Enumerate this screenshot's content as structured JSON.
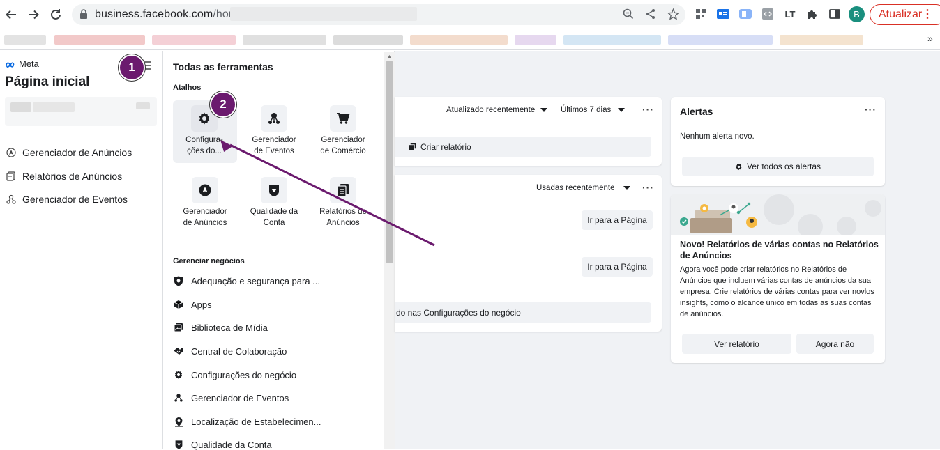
{
  "browser": {
    "url_host": "business.facebook.com",
    "url_path": "/home/a",
    "update_label": "Atualizar",
    "avatar_letter": "B"
  },
  "sidebar": {
    "brand": "Meta",
    "title": "Página inicial",
    "items": [
      {
        "label": "Gerenciador de Anúncios",
        "icon": "navigation-icon"
      },
      {
        "label": "Relatórios de Anúncios",
        "icon": "report-icon"
      },
      {
        "label": "Gerenciador de Eventos",
        "icon": "events-icon"
      }
    ]
  },
  "panel": {
    "title": "Todas as ferramentas",
    "shortcuts_heading": "Atalhos",
    "shortcuts": [
      {
        "line1": "Configura-",
        "line2": "ções do...",
        "icon": "gear-icon"
      },
      {
        "line1": "Gerenciador",
        "line2": "de Eventos",
        "icon": "events-icon"
      },
      {
        "line1": "Gerenciador",
        "line2": "de Comércio",
        "icon": "cart-icon"
      },
      {
        "line1": "Gerenciador",
        "line2": "de Anúncios",
        "icon": "navigation-icon"
      },
      {
        "line1": "Qualidade da",
        "line2": "Conta",
        "icon": "shield-icon"
      },
      {
        "line1": "Relatórios de",
        "line2": "Anúncios",
        "icon": "report-icon"
      }
    ],
    "manage_heading": "Gerenciar negócios",
    "manage_items": [
      {
        "label": "Adequação e segurança para ...",
        "icon": "shield-check-icon"
      },
      {
        "label": "Apps",
        "icon": "cube-icon"
      },
      {
        "label": "Biblioteca de Mídia",
        "icon": "media-icon"
      },
      {
        "label": "Central de Colaboração",
        "icon": "handshake-icon"
      },
      {
        "label": "Configurações do negócio",
        "icon": "gear-icon"
      },
      {
        "label": "Gerenciador de Eventos",
        "icon": "events-icon"
      },
      {
        "label": "Localização de Estabelecimen...",
        "icon": "location-icon"
      },
      {
        "label": "Qualidade da Conta",
        "icon": "shield-icon"
      }
    ]
  },
  "main": {
    "card1": {
      "updated_filter": "Atualizado recentemente",
      "period_filter": "Últimos 7 dias",
      "create_report": "Criar relatório"
    },
    "card2": {
      "used_filter": "Usadas recentemente",
      "go_to_page_1": "Ir para a Página",
      "go_to_page_2": "Ir para a Página",
      "settings_link": "do nas Configurações do negócio"
    },
    "alerts": {
      "title": "Alertas",
      "empty": "Nenhum alerta novo.",
      "see_all": "Ver todos os alertas"
    },
    "promo": {
      "title": "Novo! Relatórios de várias contas no Relatórios de Anúncios",
      "body": "Agora você pode criar relatórios no Relatórios de Anúncios que incluem várias contas de anúncios da sua empresa. Crie relatórios de várias contas para ver novlos insights, como o alcance único em todas as suas contas de anúncios.",
      "view_report": "Ver relatório",
      "not_now": "Agora não"
    }
  },
  "annotations": {
    "step1": "1",
    "step2": "2",
    "color": "#6b1a6e"
  }
}
